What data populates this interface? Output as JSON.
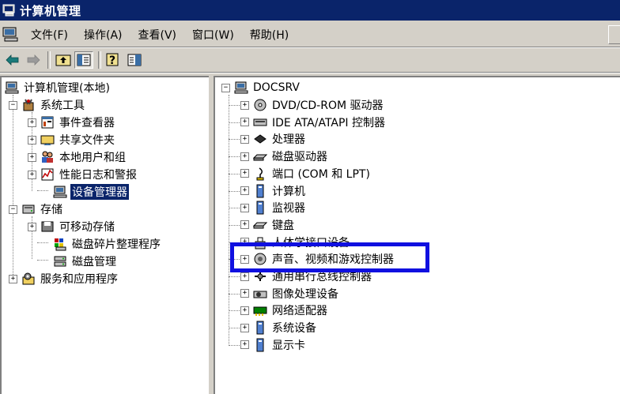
{
  "window": {
    "title": "计算机管理"
  },
  "menu": {
    "items": [
      "文件(F)",
      "操作(A)",
      "查看(V)",
      "窗口(W)",
      "帮助(H)"
    ]
  },
  "toolbar": {
    "buttons": [
      "back-arrow-icon",
      "forward-arrow-icon",
      "up-folder-icon",
      "show-hide-tree-icon",
      "help-icon",
      "properties-icon"
    ]
  },
  "left_tree": {
    "root": "计算机管理(本地)",
    "system_tools": "系统工具",
    "event_viewer": "事件查看器",
    "shared_folders": "共享文件夹",
    "local_users": "本地用户和组",
    "perf_logs": "性能日志和警报",
    "device_manager": "设备管理器",
    "storage": "存储",
    "removable_storage": "可移动存储",
    "defrag": "磁盘碎片整理程序",
    "disk_mgmt": "磁盘管理",
    "services_apps": "服务和应用程序"
  },
  "right_tree": {
    "root": "DOCSRV",
    "items": [
      "DVD/CD-ROM 驱动器",
      "IDE ATA/ATAPI 控制器",
      "处理器",
      "磁盘驱动器",
      "端口 (COM 和 LPT)",
      "计算机",
      "监视器",
      "键盘",
      "人体学接口设备",
      "声音、视频和游戏控制器",
      "通用串行总线控制器",
      "图像处理设备",
      "网络适配器",
      "系统设备",
      "显示卡"
    ]
  },
  "colors": {
    "titlebar": "#0a246a",
    "selection": "#0a246a",
    "highlight_box": "#1010e0"
  }
}
